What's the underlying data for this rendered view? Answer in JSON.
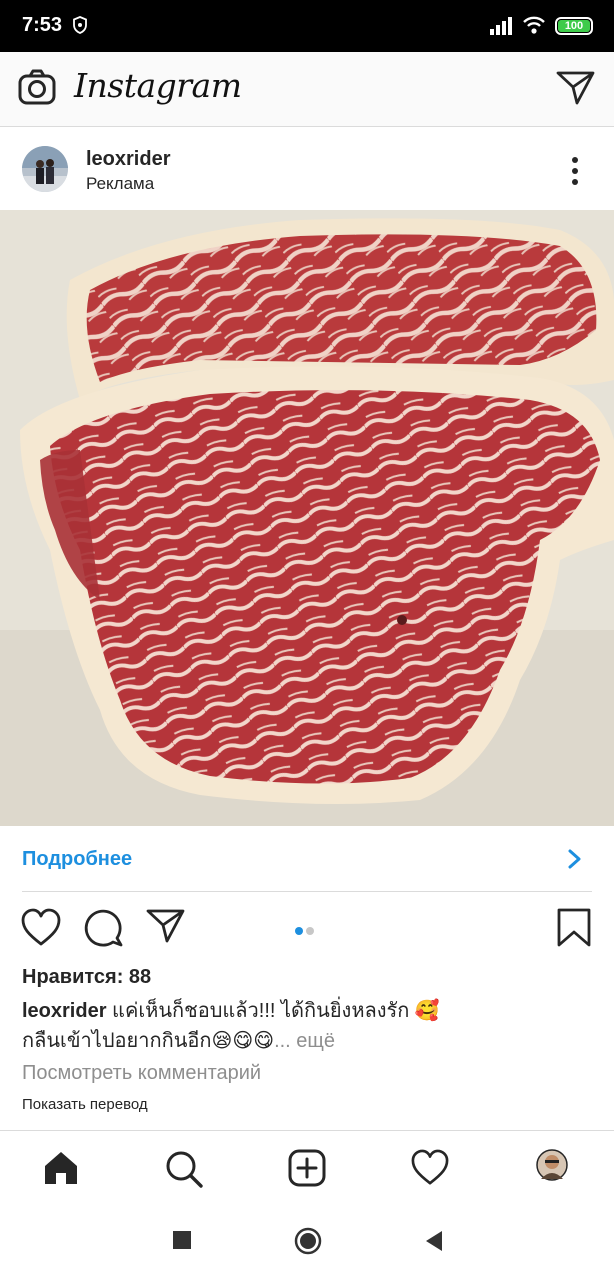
{
  "status_bar": {
    "time": "7:53",
    "battery": "100"
  },
  "app_bar": {
    "logo": "Instagram"
  },
  "post": {
    "username": "leoxrider",
    "sponsored_label": "Реклама",
    "cta_label": "Подробнее",
    "likes": "Нравится: 88",
    "caption_user": "leoxrider",
    "caption_line1": "แค่เห็นก็ชอบแล้ว!!! ได้กินยิ่งหลงรัก 🥰",
    "caption_line2": "กลืนเข้าไปอยากกินอีก😪😋😋",
    "caption_more": "... ещё",
    "view_comments": "Посмотреть комментарий",
    "show_translation": "Показать перевод",
    "carousel_index": 1,
    "carousel_total": 2
  },
  "colors": {
    "accent": "#1d8fdf",
    "battery": "#3ecb4a"
  }
}
